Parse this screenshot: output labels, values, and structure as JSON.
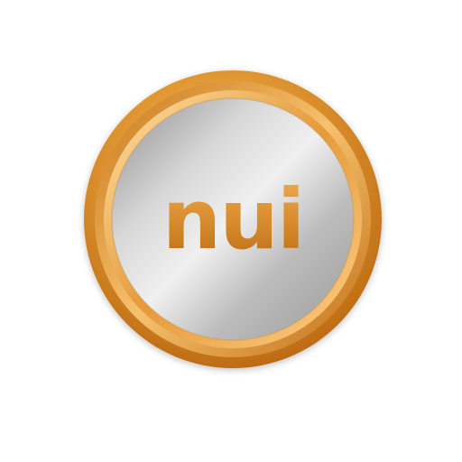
{
  "logo": {
    "text": "nui",
    "icon": "coin-logo-icon"
  },
  "colors": {
    "background": "#ffffff",
    "gold_light": "#f7c979",
    "gold_mid": "#e39a35",
    "gold_dark": "#b8650f",
    "silver_light": "#e6e6e6",
    "silver_mid": "#b9b9b9",
    "silver_dark": "#7d7d7d",
    "text_gold_light": "#f0a94d",
    "text_gold_dark": "#b96a17"
  }
}
